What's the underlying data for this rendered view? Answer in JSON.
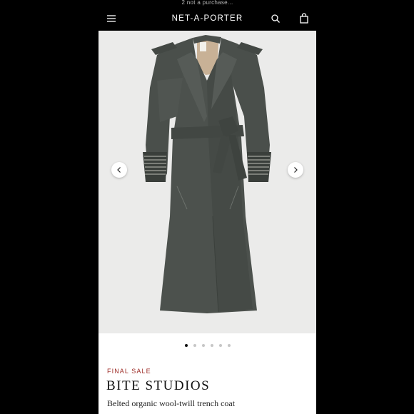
{
  "status_bar": {
    "text": "2 not a purchase..."
  },
  "header": {
    "brand": "NET-A-PORTER",
    "menu_icon": "hamburger-menu-icon",
    "search_icon": "search-icon",
    "bag_icon": "shopping-bag-icon"
  },
  "gallery": {
    "image_subject": "coat-product-image",
    "prev_icon": "chevron-left-icon",
    "next_icon": "chevron-right-icon",
    "slide_count": 6,
    "active_slide": 1
  },
  "product": {
    "sale_label": "FINAL SALE",
    "designer": "BITE STUDIOS",
    "name": "Belted organic wool-twill trench coat"
  },
  "colors": {
    "header_bg": "#000000",
    "sale": "#9c2a24",
    "coat": "#4a4f4b",
    "image_bg": "#ebebea"
  }
}
